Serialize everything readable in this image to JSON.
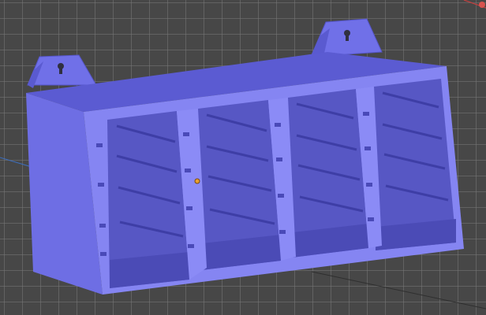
{
  "viewport": {
    "background_color": "#474747",
    "grid_color": "#7a7a7a",
    "axis_x_color": "#d9534f",
    "axis_y_color": "#4a7fd0"
  },
  "model": {
    "name": "",
    "body_color": "#6f6fe6",
    "front_color": "#8a8af4",
    "shadow_color": "#4d4dba",
    "top_color": "#5c5cd3",
    "compartments": 4,
    "shelf_rows": 5,
    "mount_tabs": 2
  },
  "icons": {
    "origin_marker": "origin-point-icon",
    "mount_hole": "keyhole-icon"
  }
}
